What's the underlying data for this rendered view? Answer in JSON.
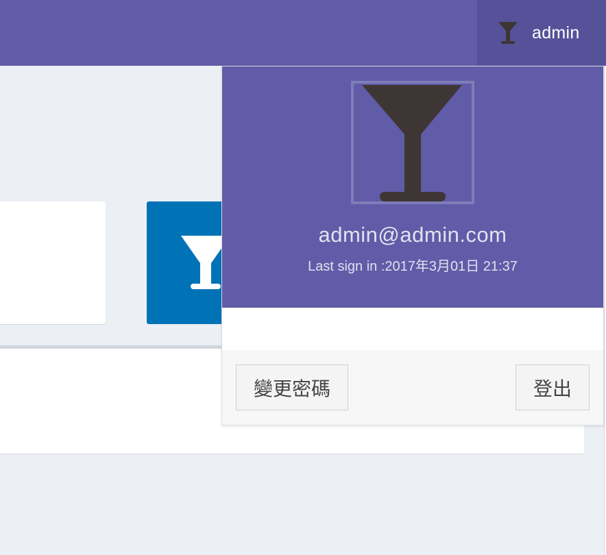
{
  "navbar": {
    "user_name": "admin",
    "icon": "cocktail-glass-icon",
    "color": "#605ca8",
    "toggle_color": "#555299"
  },
  "tile": {
    "icon": "cocktail-glass-icon",
    "color": "#0073b7"
  },
  "dropdown": {
    "avatar_icon": "cocktail-glass-icon",
    "email": "admin@admin.com",
    "last_sign_in": "Last sign in  :2017年3月01日 21:37",
    "buttons": {
      "change_password": "變更密碼",
      "logout": "登出"
    }
  }
}
